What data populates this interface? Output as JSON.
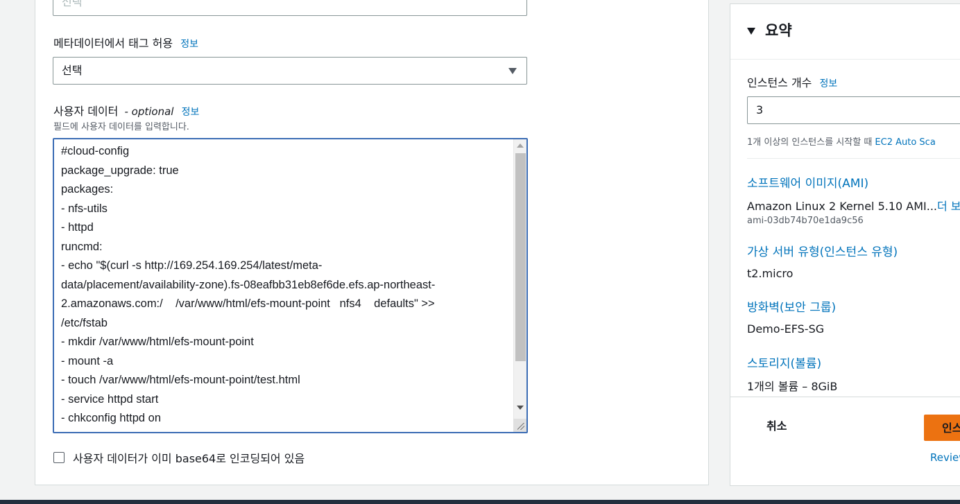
{
  "form": {
    "top_select_placeholder": "선택",
    "metadata_tags": {
      "label": "메타데이터에서 태그 허용",
      "info": "정보",
      "value": "선택"
    },
    "user_data": {
      "label": "사용자 데이터",
      "optional": "- optional",
      "info": "정보",
      "description": "필드에 사용자 데이터를 입력합니다.",
      "lines": [
        "#cloud-config",
        "package_upgrade: true",
        "packages:",
        "- nfs-utils",
        "- httpd",
        "runcmd:",
        "- echo \"$(curl -s http://169.254.169.254/latest/meta-",
        "data/placement/availability-zone).fs-08eafbb31eb8ef6de.efs.ap-northeast-",
        "2.amazonaws.com:/    /var/www/html/efs-mount-point   nfs4    defaults\" >>",
        "/etc/fstab",
        "- mkdir /var/www/html/efs-mount-point",
        "- mount -a",
        "- touch /var/www/html/efs-mount-point/test.html",
        "- service httpd start",
        "- chkconfig httpd on"
      ]
    },
    "base64_checkbox_label": "사용자 데이터가 이미 base64로 인코딩되어 있음"
  },
  "summary": {
    "title": "요약",
    "instance_count": {
      "label": "인스턴스 개수",
      "info": "정보",
      "value": "3",
      "hint_prefix": "1개 이상의 인스턴스를 시작할 때 ",
      "hint_link": "EC2 Auto Sca"
    },
    "ami": {
      "heading": "소프트웨어 이미지(AMI)",
      "value": "Amazon Linux 2 Kernel 5.10 AMI...",
      "more": "더 보",
      "id": "ami-03db74b70e1da9c56"
    },
    "instance_type": {
      "heading": "가상 서버 유형(인스턴스 유형)",
      "value": "t2.micro"
    },
    "security_group": {
      "heading": "방화벽(보안 그룹)",
      "value": "Demo-EFS-SG"
    },
    "storage": {
      "heading": "스토리지(볼륨)",
      "value": "1개의 볼륨 – 8GiB"
    }
  },
  "footer": {
    "cancel": "취소",
    "launch": "인스",
    "review": "Review"
  }
}
